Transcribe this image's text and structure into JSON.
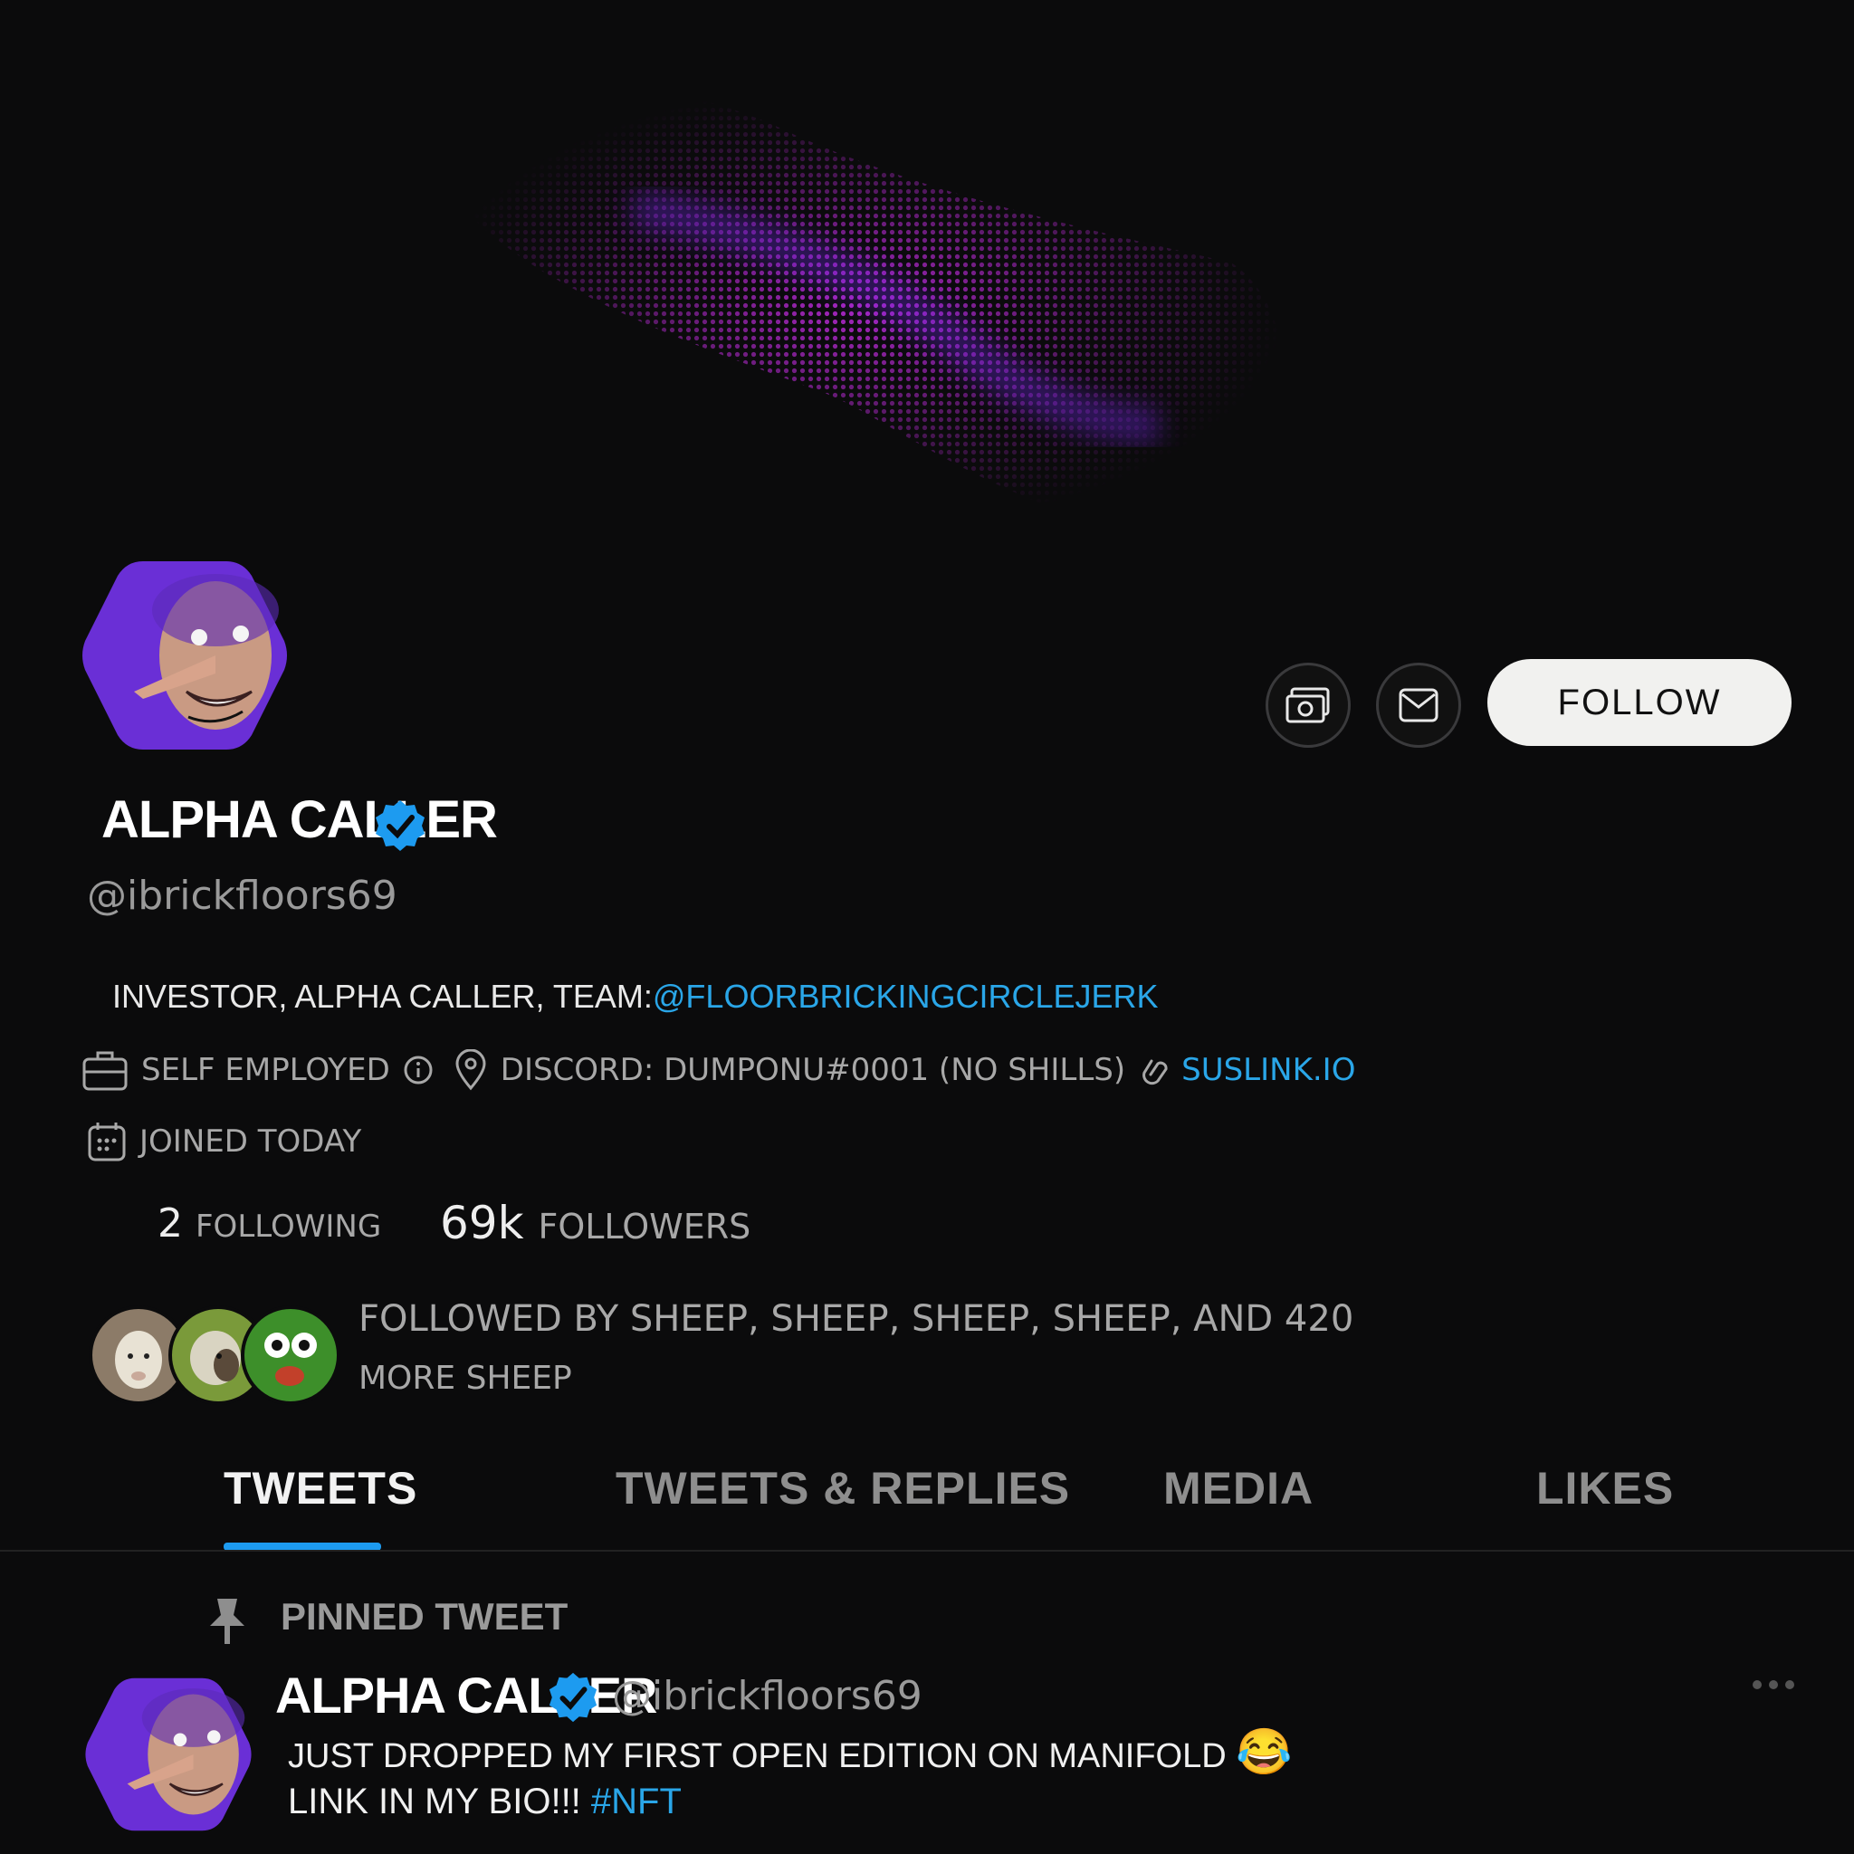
{
  "profile": {
    "display_name": "ALPHA CALLER",
    "handle": "@ibrickfloors69",
    "verified": true,
    "bio_prefix": "INVESTOR, ALPHA CALLER, TEAM:",
    "bio_mention": "@FLOORBRICKINGCIRCLEJERK",
    "occupation": "SELF EMPLOYED",
    "location": "DISCORD: DUMPONU#0001 (NO SHILLS)",
    "website": "SUSLINK.IO",
    "joined": "JOINED TODAY",
    "following_count": "2",
    "following_label": "FOLLOWING",
    "followers_count": "69k",
    "followers_label": "FOLLOWERS",
    "followed_by_line1": "FOLLOWED BY SHEEP, SHEEP, SHEEP, SHEEP, AND 420",
    "followed_by_line2": "MORE SHEEP"
  },
  "actions": {
    "follow_label": "FOLLOW",
    "tip_icon": "money-icon",
    "message_icon": "mail-icon"
  },
  "tabs": [
    {
      "label": "TWEETS",
      "active": true
    },
    {
      "label": "TWEETS & REPLIES",
      "active": false
    },
    {
      "label": "MEDIA",
      "active": false
    },
    {
      "label": "LIKES",
      "active": false
    }
  ],
  "pinned": {
    "label": "PINNED TWEET",
    "display_name": "ALPHA CALLER",
    "handle": "@ibrickfloors69",
    "text_line1": "JUST DROPPED MY FIRST OPEN EDITION ON MANIFOLD",
    "emoji": "😂",
    "text_line2": "LINK IN MY BIO!!!",
    "hashtag": "#NFT",
    "more_icon": "more-horizontal-icon"
  },
  "colors": {
    "background": "#0b0b0c",
    "accent": "#1d9bf0",
    "avatar_purple": "#6a2fd6",
    "follow_button": "#f1f1ef"
  }
}
